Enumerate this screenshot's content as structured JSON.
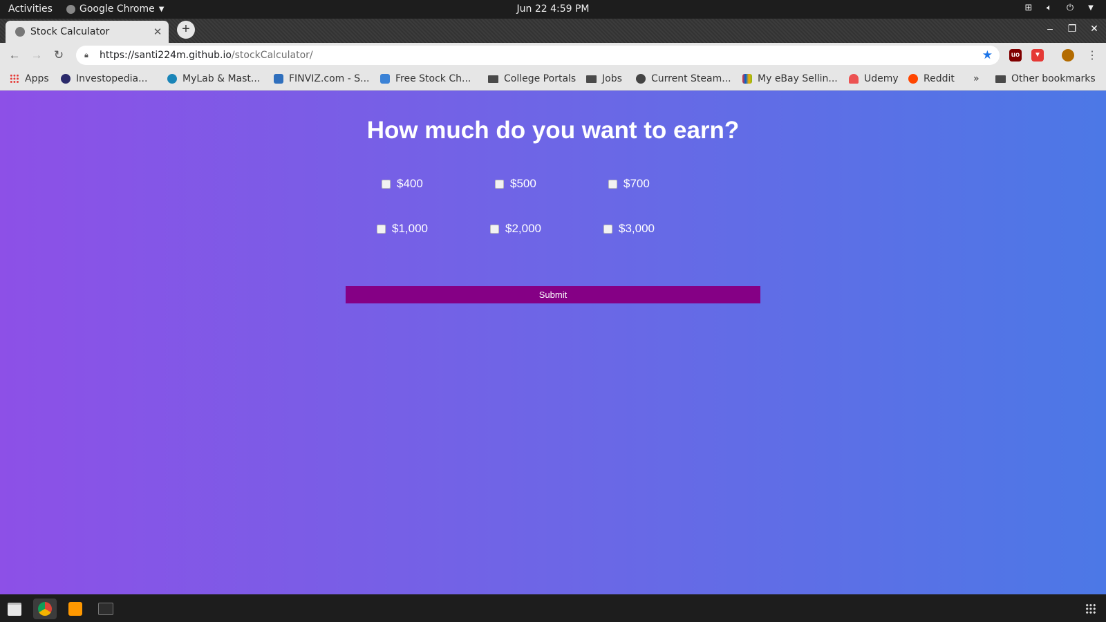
{
  "system": {
    "activities": "Activities",
    "app_name": "Google Chrome",
    "clock": "Jun 22  4:59 PM"
  },
  "browser": {
    "tab_title": "Stock Calculator",
    "url_host": "https://santi224m.github.io",
    "url_path": "/stockCalculator/",
    "bookmarks": [
      {
        "label": "Apps",
        "icon": "apps-grid-icon"
      },
      {
        "label": "Investopedia...",
        "icon": "investopedia-icon"
      },
      {
        "label": "MyLab & Mast...",
        "icon": "pearson-icon"
      },
      {
        "label": "FINVIZ.com - S...",
        "icon": "finviz-icon"
      },
      {
        "label": "Free Stock Ch...",
        "icon": "chart-icon"
      },
      {
        "label": "College Portals",
        "icon": "folder-icon"
      },
      {
        "label": "Jobs",
        "icon": "folder-icon"
      },
      {
        "label": "Current Steam...",
        "icon": "steam-icon"
      },
      {
        "label": "My eBay Sellin...",
        "icon": "ebay-icon"
      },
      {
        "label": "Udemy",
        "icon": "udemy-icon"
      },
      {
        "label": "Reddit",
        "icon": "reddit-icon"
      }
    ],
    "overflow": "»",
    "other_bookmarks": "Other bookmarks"
  },
  "page": {
    "heading": "How much do you want to earn?",
    "options": [
      "$400",
      "$500",
      "$700",
      "$1,000",
      "$2,000",
      "$3,000"
    ],
    "submit_label": "Submit"
  }
}
